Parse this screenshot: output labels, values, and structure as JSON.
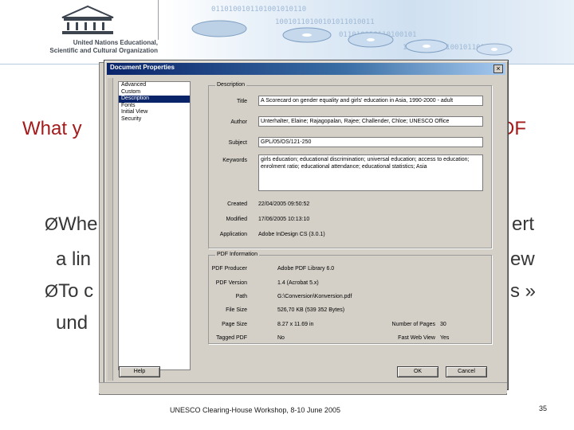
{
  "header": {
    "org_line1": "United Nations Educational,",
    "org_line2": "Scientific and Cultural Organization",
    "logo_text": "UNESCO"
  },
  "slide": {
    "title_visible_left": "What y",
    "title_visible_right": "DF",
    "bullets": [
      {
        "left": "Whe",
        "right": "ert"
      },
      {
        "left": "a lin",
        "right": "ew"
      },
      {
        "left": "To c",
        "right": "s »"
      },
      {
        "left": "und",
        "right": ""
      }
    ],
    "arrow_glyph": "Ø"
  },
  "dialog": {
    "title": "Document Properties",
    "close_glyph": "×",
    "categories": [
      "Advanced",
      "Custom",
      "Description",
      "Fonts",
      "Initial View",
      "Security"
    ],
    "selected_category": "Description",
    "description_legend": "Description",
    "fields": {
      "title_label": "Title",
      "title_value": "A Scorecard on gender equality and girls' education in Asia, 1990-2000 - adult",
      "author_label": "Author",
      "author_value": "Unterhalter, Elaine; Rajagopalan, Rajee; Challender, Chloe; UNESCO Office",
      "subject_label": "Subject",
      "subject_value": "GPL/05/OS/121-250",
      "keywords_label": "Keywords",
      "keywords_value": "girls education; educational discrimination; universal education; access to education; enrolment ratio; educational attendance; educational statistics; Asia",
      "created_label": "Created",
      "created_value": "22/04/2005 09:50:52",
      "modified_label": "Modified",
      "modified_value": "17/06/2005 10:13:10",
      "application_label": "Application",
      "application_value": "Adobe InDesign CS (3.0.1)"
    },
    "pdf_legend": "PDF Information",
    "pdf": {
      "producer_label": "PDF Producer",
      "producer_value": "Adobe PDF Library 6.0",
      "version_label": "PDF Version",
      "version_value": "1.4 (Acrobat 5.x)",
      "path_label": "Path",
      "path_value": "G:\\Conversion\\Konversion.pdf",
      "filesize_label": "File Size",
      "filesize_value": "526,70 KB (539 352 Bytes)",
      "pagesize_label": "Page Size",
      "pagesize_value": "8.27 x 11.69 in",
      "tagged_label": "Tagged PDF",
      "tagged_value": "No",
      "pages_label": "Number of Pages",
      "pages_value": "30",
      "fastweb_label": "Fast Web View",
      "fastweb_value": "Yes"
    },
    "buttons": {
      "help": "Help",
      "ok": "OK",
      "cancel": "Cancel"
    }
  },
  "footer": {
    "text": "UNESCO Clearing-House Workshop, 8-10 June 2005",
    "page_number": "35"
  },
  "colors": {
    "title_red": "#a31b1b",
    "dialog_face": "#d4d0c8",
    "titlebar_blue": "#0a246a",
    "selection_blue": "#0a246a"
  }
}
